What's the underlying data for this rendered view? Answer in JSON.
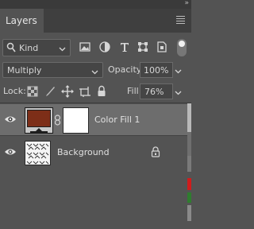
{
  "panel": {
    "tab_label": "Layers",
    "collapse_glyph": "»",
    "menu_icon": "hamburger-icon"
  },
  "filter": {
    "kind_label": "Kind",
    "icons": [
      "image-filter-icon",
      "adjustment-filter-icon",
      "type-filter-icon",
      "shape-filter-icon",
      "smart-object-filter-icon"
    ]
  },
  "blend": {
    "mode": "Multiply",
    "opacity_label": "Opacity:",
    "opacity_value": "100%"
  },
  "lock": {
    "label": "Lock:",
    "icons": [
      "lock-transparent-pixels-icon",
      "lock-image-pixels-icon",
      "lock-position-icon",
      "prevent-auto-nesting-icon",
      "lock-all-icon"
    ],
    "fill_label": "Fill:",
    "fill_value": "76%"
  },
  "layers": [
    {
      "name": "Color Fill 1",
      "selected": true,
      "visible": true,
      "fill_color": "#7d2e18",
      "has_mask": true
    },
    {
      "name": "Background",
      "selected": false,
      "visible": true,
      "locked": true
    }
  ],
  "colors": {
    "panel_bg": "#535353",
    "selected_row": "#6d6d6d",
    "fill_swatch": "#7d2e18"
  }
}
